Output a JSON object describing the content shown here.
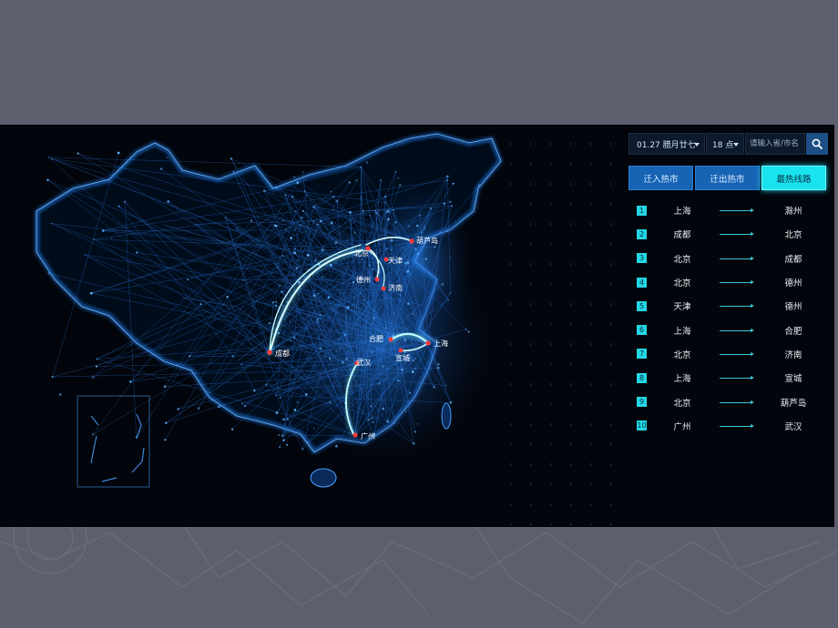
{
  "controls": {
    "date_label": "01.27 腊月廿七",
    "hour_label": "18 点",
    "city_input_placeholder": "请输入省/市名"
  },
  "tabs": [
    {
      "label": "迁入热市",
      "active": false
    },
    {
      "label": "迁出热市",
      "active": false
    },
    {
      "label": "最热线路",
      "active": true
    }
  ],
  "routes": [
    {
      "rank": "1",
      "from": "上海",
      "to": "滁州"
    },
    {
      "rank": "2",
      "from": "成都",
      "to": "北京"
    },
    {
      "rank": "3",
      "from": "北京",
      "to": "成都"
    },
    {
      "rank": "4",
      "from": "北京",
      "to": "德州"
    },
    {
      "rank": "5",
      "from": "天津",
      "to": "德州"
    },
    {
      "rank": "6",
      "from": "上海",
      "to": "合肥"
    },
    {
      "rank": "7",
      "from": "北京",
      "to": "济南"
    },
    {
      "rank": "8",
      "from": "上海",
      "to": "宣城"
    },
    {
      "rank": "9",
      "from": "北京",
      "to": "葫芦岛"
    },
    {
      "rank": "10",
      "from": "广州",
      "to": "武汉"
    }
  ],
  "map_cities": {
    "huludao": "葫芦岛",
    "beijing": "北京",
    "tianjin": "天津",
    "dezhou": "德州",
    "jinan": "济南",
    "chengdu": "成都",
    "hefei": "合肥",
    "shanghai": "上海",
    "wuhan": "武汉",
    "xuancheng": "宣城",
    "guangzhou": "广州"
  },
  "colors": {
    "background": "#02050b",
    "accent_cyan": "#19e3ee",
    "tab_blue": "#1764b4",
    "map_glow": "#1e7bff"
  }
}
